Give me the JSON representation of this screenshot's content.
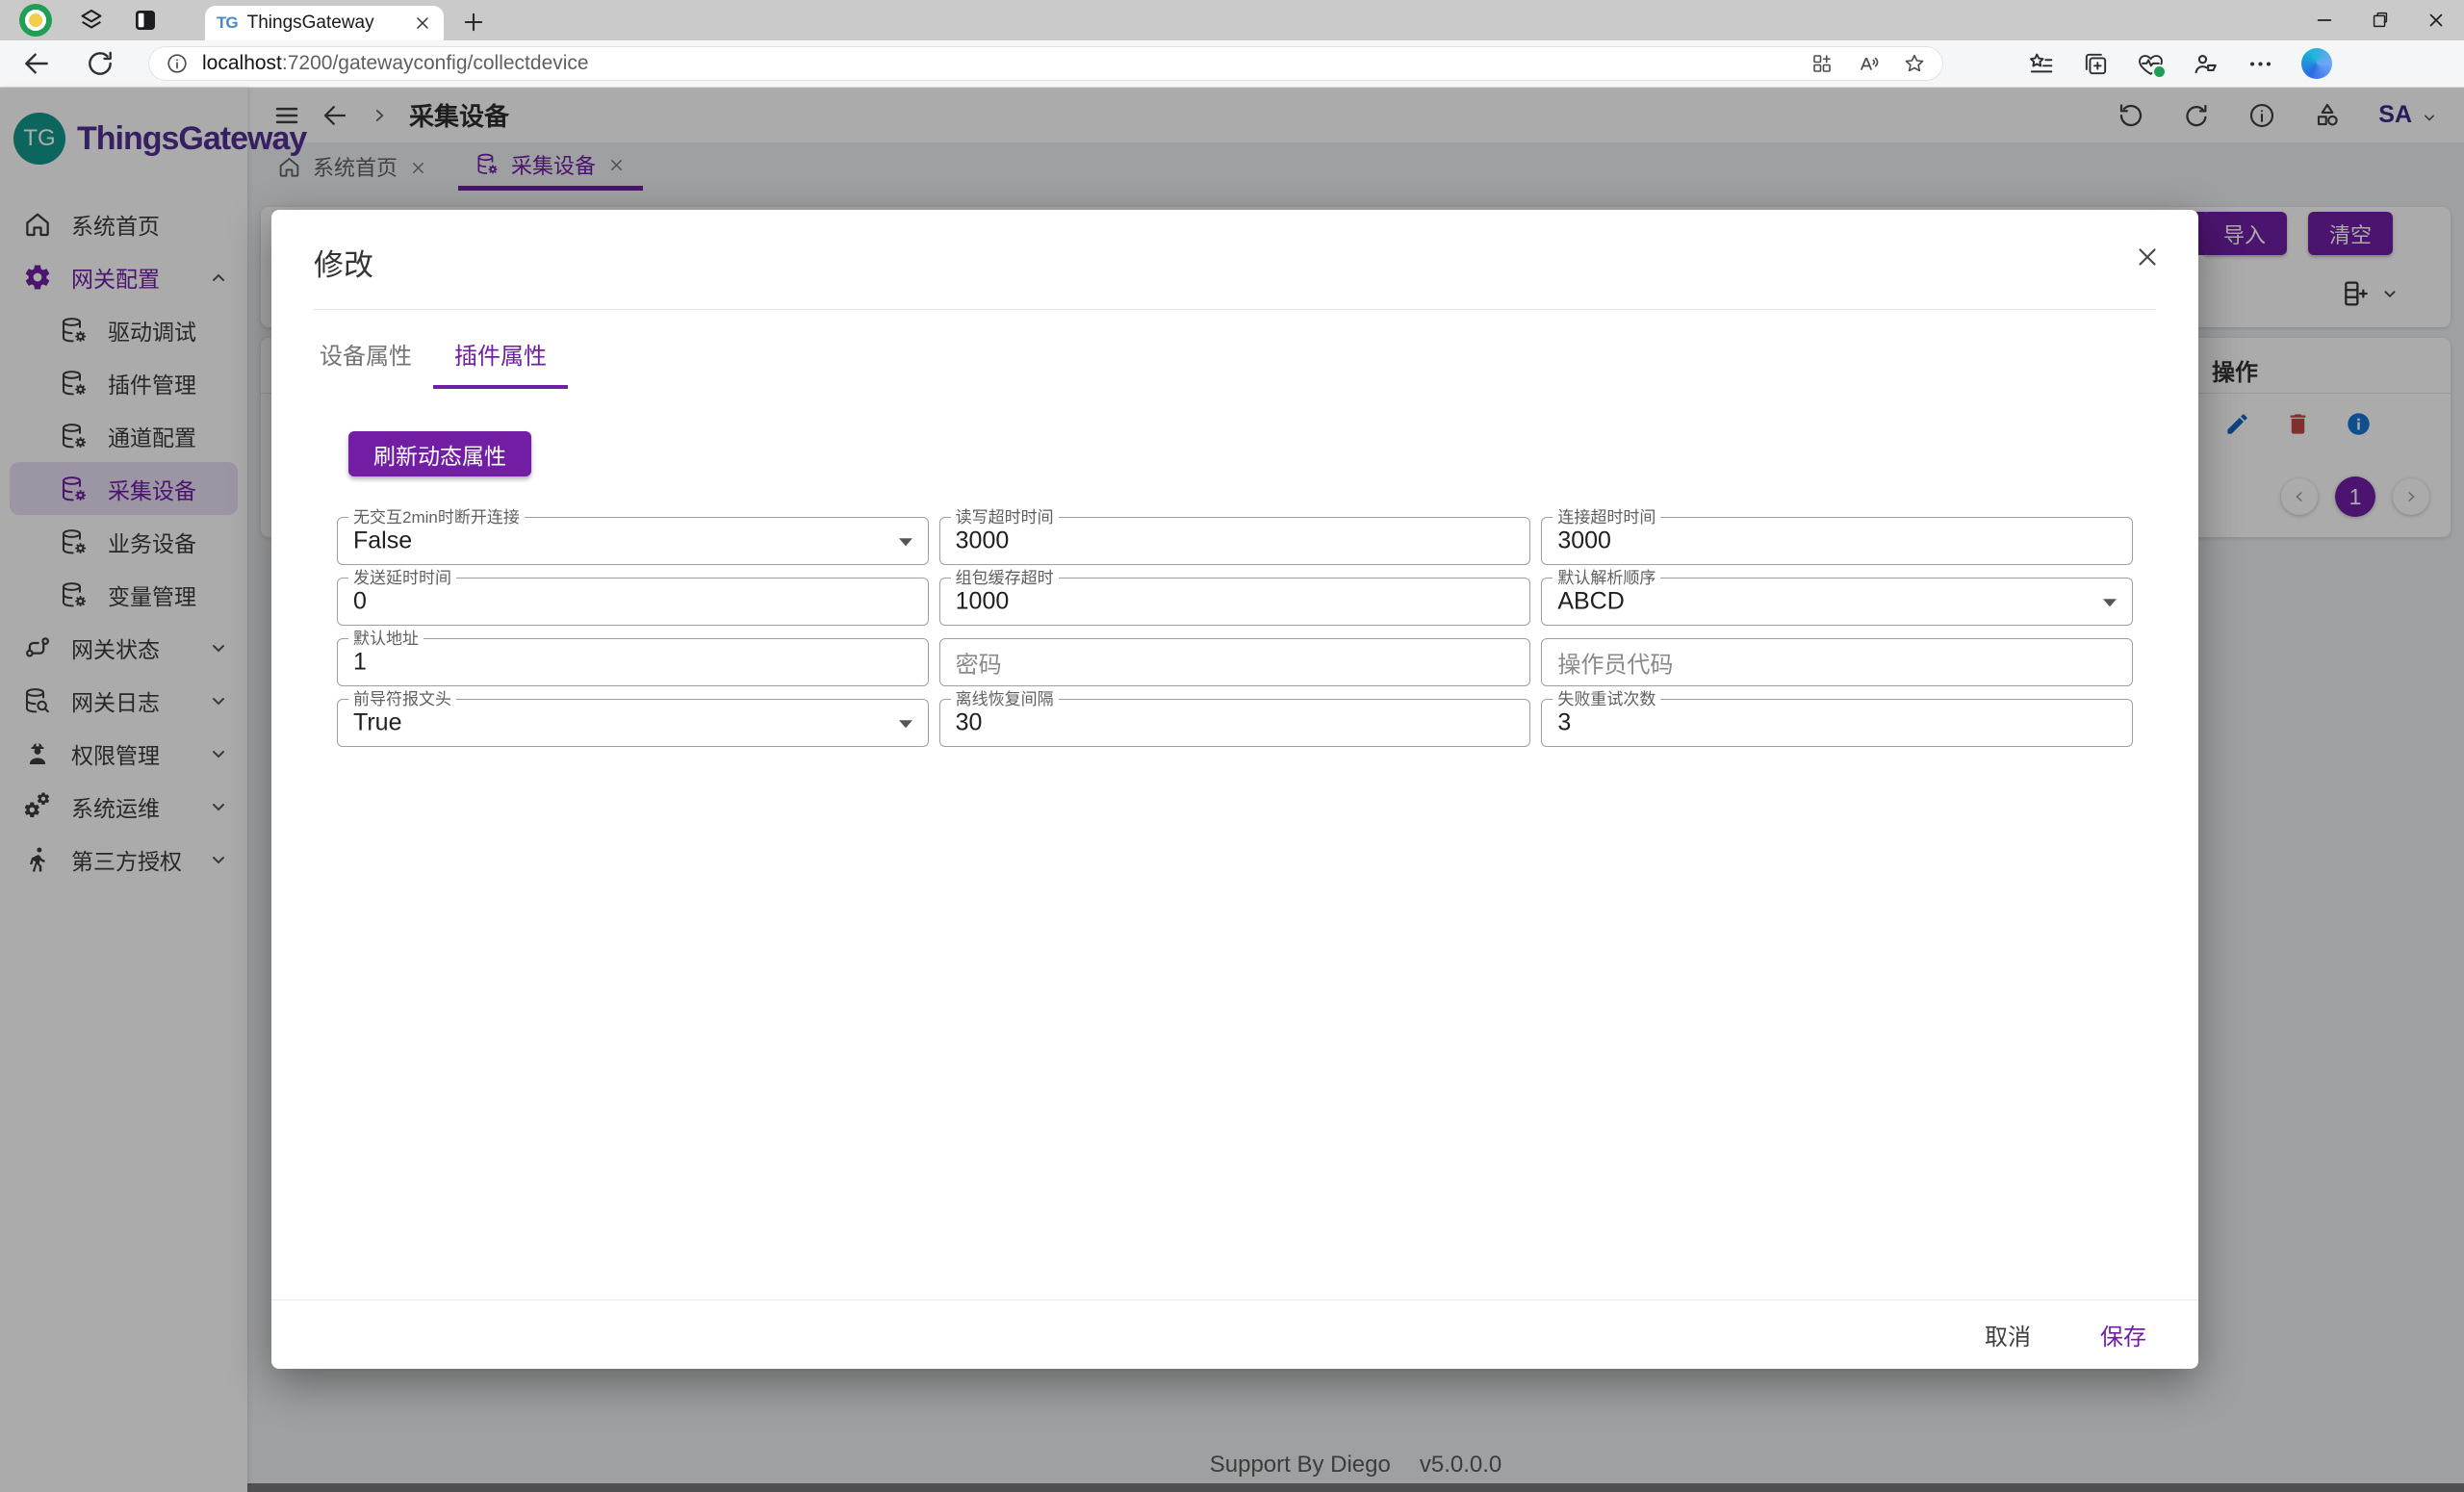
{
  "browser": {
    "tab": {
      "favicon": "TG",
      "title": "ThingsGateway"
    },
    "url": {
      "host": "localhost",
      "path": ":7200/gatewayconfig/collectdevice"
    },
    "toolbar_icons": [
      "back-icon",
      "refresh-icon",
      "info-icon",
      "apps-grid-icon",
      "read-aloud-icon",
      "favorite-star-icon",
      "split-screen-icon",
      "favorites-bar-icon",
      "collections-icon",
      "browser-essentials-icon",
      "profile-icon",
      "more-options-icon",
      "copilot-icon"
    ]
  },
  "sidebar": {
    "logo_badge": "TG",
    "logo_text": "ThingsGateway",
    "items": [
      {
        "label": "系统首页",
        "icon": "home",
        "type": "item"
      },
      {
        "label": "网关配置",
        "icon": "gear",
        "type": "group-open",
        "active": true
      },
      {
        "label": "驱动调试",
        "icon": "db-gear",
        "type": "sub"
      },
      {
        "label": "插件管理",
        "icon": "db-gear",
        "type": "sub"
      },
      {
        "label": "通道配置",
        "icon": "db-gear",
        "type": "sub"
      },
      {
        "label": "采集设备",
        "icon": "db-gear",
        "type": "sub",
        "active": true
      },
      {
        "label": "业务设备",
        "icon": "db-gear",
        "type": "sub"
      },
      {
        "label": "变量管理",
        "icon": "db-gear",
        "type": "sub"
      },
      {
        "label": "网关状态",
        "icon": "workflow",
        "type": "group"
      },
      {
        "label": "网关日志",
        "icon": "db-search",
        "type": "group"
      },
      {
        "label": "权限管理",
        "icon": "user",
        "type": "group"
      },
      {
        "label": "系统运维",
        "icon": "gears",
        "type": "group"
      },
      {
        "label": "第三方授权",
        "icon": "walker",
        "type": "group"
      }
    ]
  },
  "app_header": {
    "breadcrumb": "采集设备",
    "user_initials": "SA",
    "icons": [
      "refresh-ccw-icon",
      "refresh-cw-icon",
      "info-circle-icon",
      "shapes-icon"
    ]
  },
  "workspace_tabs": [
    {
      "label": "系统首页",
      "icon": "home"
    },
    {
      "label": "采集设备",
      "icon": "db-gear",
      "active": true
    }
  ],
  "toolbar_card": {
    "import_label": "导入",
    "clear_label": "清空",
    "column_settings_icon": "table-columns-plus-icon"
  },
  "table_card": {
    "operation_header": "操作",
    "row_action_icons": [
      "edit-pencil-icon",
      "delete-trash-icon",
      "info-circle-icon"
    ],
    "page": "1"
  },
  "modal": {
    "title": "修改",
    "tabs": [
      {
        "label": "设备属性"
      },
      {
        "label": "插件属性",
        "active": true
      }
    ],
    "refresh_button": "刷新动态属性",
    "fields": [
      {
        "label": "无交互2min时断开连接",
        "value": "False",
        "type": "select"
      },
      {
        "label": "读写超时时间",
        "value": "3000",
        "type": "text"
      },
      {
        "label": "连接超时时间",
        "value": "3000",
        "type": "text"
      },
      {
        "label": "发送延时时间",
        "value": "0",
        "type": "text"
      },
      {
        "label": "组包缓存超时",
        "value": "1000",
        "type": "text"
      },
      {
        "label": "默认解析顺序",
        "value": "ABCD",
        "type": "select"
      },
      {
        "label": "默认地址",
        "value": "1",
        "type": "text"
      },
      {
        "label": "密码",
        "value": "",
        "type": "empty"
      },
      {
        "label": "操作员代码",
        "value": "",
        "type": "empty"
      },
      {
        "label": "前导符报文头",
        "value": "True",
        "type": "select"
      },
      {
        "label": "离线恢复间隔",
        "value": "30",
        "type": "text"
      },
      {
        "label": "失败重试次数",
        "value": "3",
        "type": "text"
      }
    ],
    "cancel_label": "取消",
    "save_label": "保存"
  },
  "page_footer": {
    "credit": "Support By Diego",
    "version": "v5.0.0.0"
  },
  "colors": {
    "primary": "#711ea5",
    "logo_purple": "#523093",
    "logo_teal": "#14988b",
    "active_item_bg": "#e9def5",
    "edit_blue": "#1565c0",
    "delete_red": "#c14545",
    "info_blue": "#1976d2",
    "essentials_green": "#1f9e54"
  }
}
